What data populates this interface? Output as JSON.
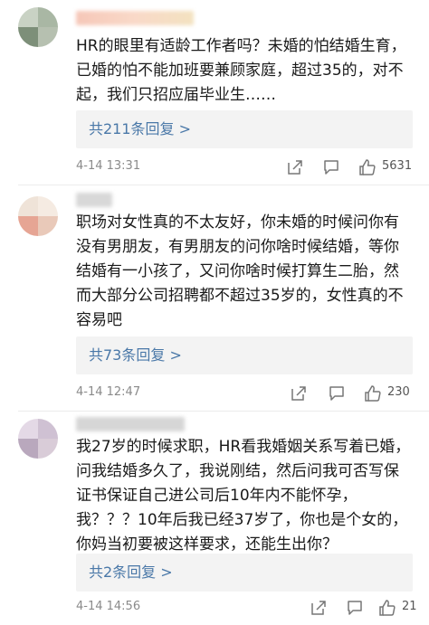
{
  "comments": [
    {
      "text": "HR的眼里有适龄工作者吗？未婚的怕结婚生育，已婚的怕不能加班要兼顾家庭，超过35的，对不起，我们只招应届毕业生……",
      "replies": "共211条回复 >",
      "time": "4-14 13:31",
      "likes": "5631"
    },
    {
      "text": "职场对女性真的不太友好，你未婚的时候问你有没有男朋友，有男朋友的问你啥时候结婚，等你结婚有一小孩了，又问你啥时候打算生二胎，然而大部分公司招聘都不超过35岁的，女性真的不容易吧",
      "replies": "共73条回复 >",
      "time": "4-14 12:47",
      "likes": "230"
    },
    {
      "text": "我27岁的时候求职，HR看我婚姻关系写着已婚，问我结婚多久了，我说刚结，然后问我可否写保证书保证自己进公司后10年内不能怀孕，我？？？10年后我已经37岁了，你也是个女的，你妈当初要被这样要求，还能生出你？",
      "replies": "共2条回复 >",
      "time": "4-14 14:56",
      "likes": "21"
    }
  ],
  "icons": {
    "share": "share-icon",
    "comment": "comment-icon",
    "like": "like-icon"
  },
  "colors": {
    "reply_link": "#4a78a8",
    "meta_text": "#8a8a8a",
    "reply_bg": "#f3f3f3"
  }
}
